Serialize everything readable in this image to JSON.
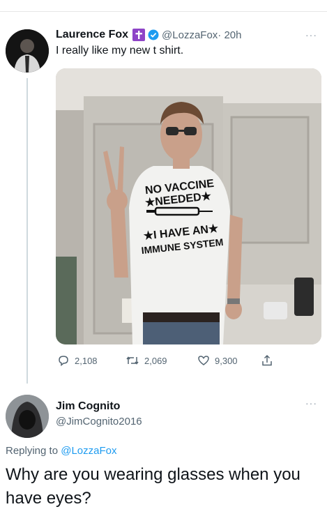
{
  "tweet": {
    "author_name": "Laurence Fox",
    "handle": "@LozzaFox",
    "time": "· 20h",
    "text": "I really like my new t shirt.",
    "shirt_lines": [
      "NO VACCINE",
      "★NEEDED★",
      "★I HAVE AN★",
      "IMMUNE SYSTEM"
    ],
    "stats": {
      "replies": "2,108",
      "retweets": "2,069",
      "likes": "9,300"
    },
    "more": "···"
  },
  "reply": {
    "author_name": "Jim Cognito",
    "handle": "@JimCognito2016",
    "replying_prefix": "Replying to",
    "replying_to": "@LozzaFox",
    "text": "Why are you wearing glasses when you have eyes?",
    "more": "···"
  },
  "colors": {
    "name": "#0f1419",
    "secondary": "#536471",
    "link": "#1d9bf0",
    "verified": "#1d9bf0",
    "badge": "#8e44c7"
  },
  "icons": [
    "cross-badge-icon",
    "verified-icon",
    "reply-icon",
    "retweet-icon",
    "like-icon",
    "share-icon"
  ]
}
